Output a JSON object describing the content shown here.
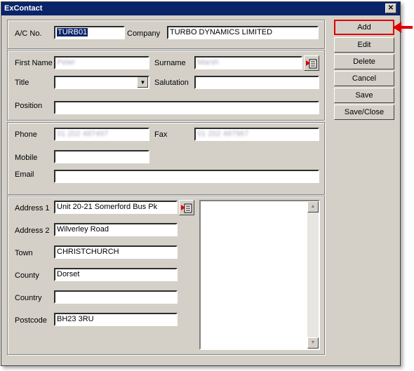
{
  "window": {
    "title": "ExContact",
    "close_glyph": "✕"
  },
  "account": {
    "ac_no_label": "A/C No.",
    "ac_no_value": "TURB01",
    "company_label": "Company",
    "company_value": "TURBO DYNAMICS LIMITED"
  },
  "person": {
    "first_name_label": "First Name",
    "first_name_value": "Peter",
    "surname_label": "Surname",
    "surname_value": "Marsh",
    "title_label": "Title",
    "title_value": "",
    "salutation_label": "Salutation",
    "salutation_value": "",
    "position_label": "Position",
    "position_value": ""
  },
  "contact": {
    "phone_label": "Phone",
    "phone_value": "01 202 487497",
    "fax_label": "Fax",
    "fax_value": "01 202 487967",
    "mobile_label": "Mobile",
    "mobile_value": "",
    "email_label": "Email",
    "email_value": ""
  },
  "address": {
    "address1_label": "Address 1",
    "address1_value": "Unit 20-21 Somerford Bus Pk",
    "address2_label": "Address 2",
    "address2_value": "Wilverley Road",
    "town_label": "Town",
    "town_value": "CHRISTCHURCH",
    "county_label": "County",
    "county_value": "Dorset",
    "country_label": "Country",
    "country_value": "",
    "postcode_label": "Postcode",
    "postcode_value": "BH23 3RU",
    "notes_value": ""
  },
  "buttons": {
    "add": "Add",
    "edit": "Edit",
    "delete": "Delete",
    "cancel": "Cancel",
    "save": "Save",
    "save_close": "Save/Close"
  },
  "colors": {
    "highlight": "#e00000",
    "titlebar": "#0a246a"
  },
  "icons": {
    "lookup": "card-lookup-icon",
    "callout": "red-arrow-pointer"
  }
}
